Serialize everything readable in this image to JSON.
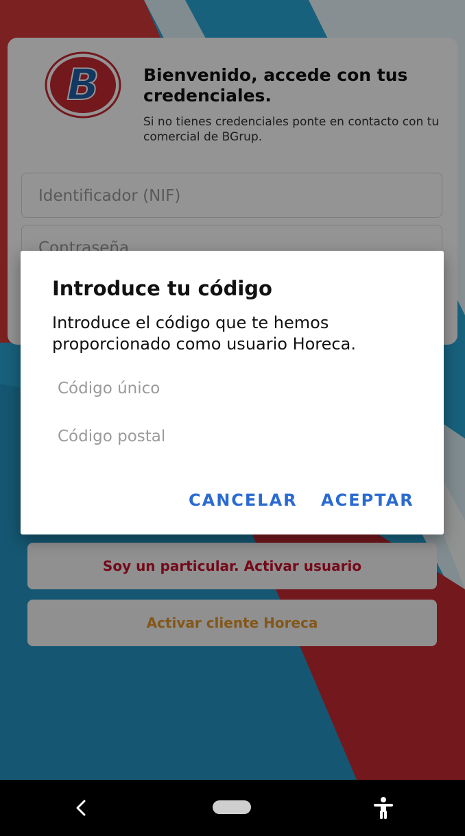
{
  "colors": {
    "brand_red": "#c62a33",
    "brand_blue": "#1f5fa8",
    "accent_blue": "#2a6ad2",
    "particular_text": "#c8102e",
    "horeca_text": "#e2962b"
  },
  "login": {
    "logo_letter": "B",
    "title": "Bienvenido, accede con tus credenciales.",
    "subtitle": "Si no tienes credenciales ponte en contacto con tu comercial de BGrup.",
    "id_placeholder": "Identificador (NIF)",
    "password_placeholder": "Contraseña"
  },
  "buttons": {
    "particular": "Soy un particular. Activar usuario",
    "horeca": "Activar cliente Horeca"
  },
  "dialog": {
    "title": "Introduce tu código",
    "message": "Introduce el código que te hemos proporcionado como usuario Horeca.",
    "code_placeholder": "Código único",
    "postal_placeholder": "Código postal",
    "cancel": "CANCELAR",
    "accept": "ACEPTAR"
  },
  "navbar": {
    "icons": [
      "back-icon",
      "home-pill-icon",
      "accessibility-icon"
    ]
  }
}
